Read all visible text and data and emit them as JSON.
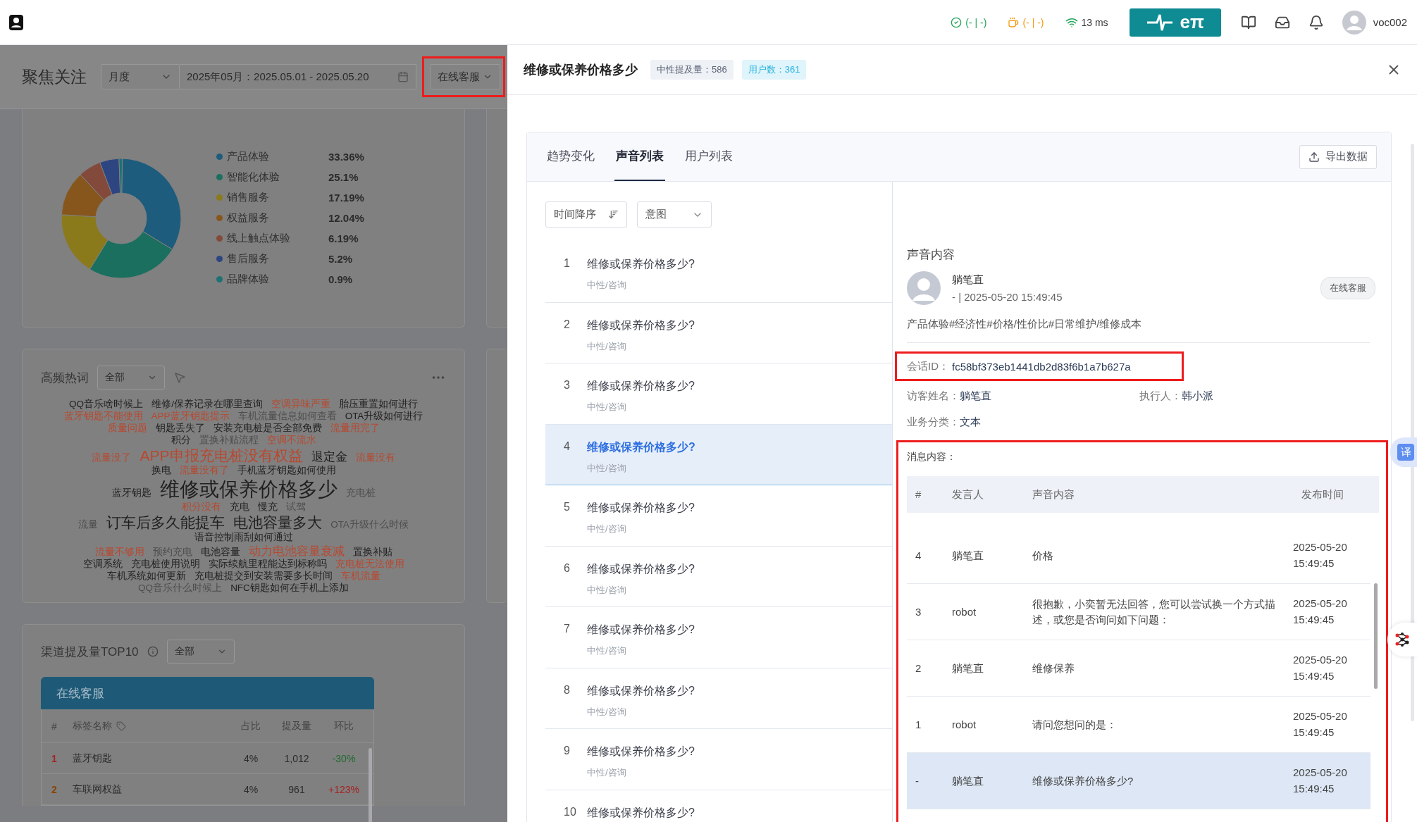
{
  "top_bar": {
    "status": [
      {
        "kind": "check",
        "text": "(- | -)"
      },
      {
        "kind": "cup",
        "text": "(- | -)"
      },
      {
        "kind": "wifi",
        "text": "13 ms"
      }
    ],
    "logo_text": "eπ",
    "username": "voc002"
  },
  "focus": {
    "title": "聚焦关注",
    "period": "月度",
    "date_range": "2025年05月：2025.05.01 - 2025.05.20",
    "channel": {
      "value": "在线客服",
      "highlighted": true
    }
  },
  "distribution": {
    "chart_data": {
      "type": "donut",
      "categories": [
        "产品体验",
        "智能化体验",
        "销售服务",
        "权益服务",
        "线上触点体验",
        "售后服务",
        "品牌体验"
      ],
      "values": [
        33.36,
        25.1,
        17.19,
        12.04,
        6.19,
        5.2,
        0.9
      ]
    },
    "legend": [
      {
        "value": "33.36%",
        "color": "#1d5c7d"
      },
      {
        "value": "25.1%",
        "color": "#1b6f5f"
      },
      {
        "value": "17.19%",
        "color": "#8a7a1c"
      },
      {
        "value": "12.04%",
        "color": "#87561c"
      },
      {
        "value": "6.19%",
        "color": "#834a3c"
      },
      {
        "value": "5.2%",
        "color": "#2d4580"
      },
      {
        "value": "0.9%",
        "color": "#1e7272"
      }
    ]
  },
  "hot_words": {
    "title": "高频热词",
    "filter": "全部",
    "lines": [
      [
        {
          "text": "QQ音乐啥时候上",
          "color": "#1f1f1f",
          "kind": "s"
        },
        {
          "text": "维修/保养记录在哪里查询",
          "color": "#1f1f1f",
          "kind": "s"
        },
        {
          "text": "空调异味严重",
          "color": "#b8482f",
          "kind": "s"
        },
        {
          "text": "胎压重置如何进行",
          "color": "#1f1f1f",
          "kind": "s"
        }
      ],
      [
        {
          "text": "蓝牙钥匙不能使用",
          "color": "#b8482f",
          "kind": "s"
        },
        {
          "text": "APP蓝牙钥匙提示",
          "color": "#b8482f",
          "kind": "s"
        },
        {
          "text": "车机流量信息如何查看",
          "color": "#4d4d4d",
          "kind": "s"
        },
        {
          "text": "OTA升级如何进行",
          "color": "#1f1f1f",
          "kind": "s"
        }
      ],
      [
        {
          "text": "质量问题",
          "color": "#b8482f",
          "kind": "s"
        },
        {
          "text": "钥匙丢失了",
          "color": "#1f1f1f",
          "kind": "s"
        },
        {
          "text": "安装充电桩是否全部免费",
          "color": "#1f1f1f",
          "kind": "s"
        },
        {
          "text": "流量用完了",
          "color": "#b8482f",
          "kind": "s"
        }
      ],
      [
        {
          "text": "积分",
          "color": "#1f1f1f",
          "kind": "s"
        },
        {
          "text": "置换补贴流程",
          "color": "#4d4d4d",
          "kind": "s"
        },
        {
          "text": "空调不流水",
          "color": "#b8482f",
          "kind": "s"
        }
      ],
      [
        {
          "text": "流量没了",
          "color": "#b8482f",
          "kind": "s"
        },
        {
          "text": "APP申报充电桩没有权益",
          "color": "#b8482f",
          "kind": "l"
        },
        {
          "text": "退定金",
          "color": "#1f1f1f",
          "kind": "m"
        },
        {
          "text": "流量没有",
          "color": "#b8482f",
          "kind": "s"
        }
      ],
      [
        {
          "text": "换电",
          "color": "#1f1f1f",
          "kind": "s"
        },
        {
          "text": "流量没有了",
          "color": "#b8482f",
          "kind": "s"
        },
        {
          "text": "手机蓝牙钥匙如何使用",
          "color": "#1f1f1f",
          "kind": "s"
        }
      ],
      [
        {
          "text": "蓝牙钥匙",
          "color": "#1f1f1f",
          "kind": "s"
        },
        {
          "text": "维修或保养价格多少",
          "color": "#1f1f1f",
          "kind": "xl"
        },
        {
          "text": "充电桩",
          "color": "#4d4d4d",
          "kind": "s"
        }
      ],
      [
        {
          "text": "积分没有",
          "color": "#b8482f",
          "kind": "s"
        },
        {
          "text": "充电",
          "color": "#1f1f1f",
          "kind": "s"
        },
        {
          "text": "慢充",
          "color": "#1f1f1f",
          "kind": "s"
        },
        {
          "text": "试驾",
          "color": "#4d4d4d",
          "kind": "s"
        }
      ],
      [
        {
          "text": "流量",
          "color": "#4d4d4d",
          "kind": "s"
        },
        {
          "text": "订车后多久能提车",
          "color": "#1f1f1f",
          "kind": "l"
        },
        {
          "text": "电池容量多大",
          "color": "#1f1f1f",
          "kind": "l"
        },
        {
          "text": "OTA升级什么时候",
          "color": "#4d4d4d",
          "kind": "s"
        }
      ],
      [
        {
          "text": "语音控制雨刮如何通过",
          "color": "#1f1f1f",
          "kind": "s"
        }
      ],
      [
        {
          "text": "流量不够用",
          "color": "#b8482f",
          "kind": "s"
        },
        {
          "text": "预约充电",
          "color": "#4d4d4d",
          "kind": "s"
        },
        {
          "text": "电池容量",
          "color": "#1f1f1f",
          "kind": "s"
        },
        {
          "text": "动力电池容量衰减",
          "color": "#b8482f",
          "kind": "m"
        },
        {
          "text": "置换补贴",
          "color": "#1f1f1f",
          "kind": "s"
        }
      ],
      [
        {
          "text": "空调系统",
          "color": "#1f1f1f",
          "kind": "s"
        },
        {
          "text": "充电桩使用说明",
          "color": "#1f1f1f",
          "kind": "s"
        },
        {
          "text": "实际续航里程能达到标称吗",
          "color": "#1f1f1f",
          "kind": "s"
        },
        {
          "text": "充电桩无法使用",
          "color": "#b8482f",
          "kind": "s"
        }
      ],
      [
        {
          "text": "车机系统如何更新",
          "color": "#1f1f1f",
          "kind": "s"
        },
        {
          "text": "充电桩提交到安装需要多长时间",
          "color": "#1f1f1f",
          "kind": "s"
        },
        {
          "text": "车机流量",
          "color": "#b8482f",
          "kind": "s"
        }
      ],
      [
        {
          "text": "QQ音乐什么时候上",
          "color": "#4d4d4d",
          "kind": "s"
        },
        {
          "text": "NFC钥匙如何在手机上添加",
          "color": "#1f1f1f",
          "kind": "s"
        }
      ]
    ]
  },
  "channel_top": {
    "title": "渠道提及量TOP10",
    "filter": "全部",
    "channel": "在线客服",
    "columns": [
      "#",
      "标签名称",
      "占比",
      "提及量",
      "环比"
    ],
    "rows": [
      {
        "rank": "1",
        "color": "#a32424",
        "name": "蓝牙钥匙",
        "share": "4%",
        "mentions": "1,012",
        "change": "-30%",
        "kind": "down"
      },
      {
        "rank": "2",
        "color": "#8a4206",
        "name": "车联网权益",
        "share": "4%",
        "mentions": "961",
        "change": "+123%",
        "kind": "up"
      }
    ]
  },
  "drawer": {
    "title": "维修或保养价格多少",
    "tags": [
      {
        "text": "中性提及量：586",
        "kind": "neutral"
      },
      {
        "text": "用户数：361",
        "kind": "users"
      }
    ],
    "tabs": [
      {
        "label": "趋势变化",
        "selected": false
      },
      {
        "label": "声音列表",
        "selected": true
      },
      {
        "label": "用户列表",
        "selected": false
      }
    ],
    "export": "导出数据",
    "sort": "时间降序",
    "intent": "意图",
    "voices": [
      {
        "index": "1",
        "text": "维修或保养价格多少?",
        "sub": "中性/咨询",
        "selected": false
      },
      {
        "index": "2",
        "text": "维修或保养价格多少?",
        "sub": "中性/咨询",
        "selected": false
      },
      {
        "index": "3",
        "text": "维修或保养价格多少?",
        "sub": "中性/咨询",
        "selected": false
      },
      {
        "index": "4",
        "text": "维修或保养价格多少?",
        "sub": "中性/咨询",
        "selected": true
      },
      {
        "index": "5",
        "text": "维修或保养价格多少?",
        "sub": "中性/咨询",
        "selected": false
      },
      {
        "index": "6",
        "text": "维修或保养价格多少?",
        "sub": "中性/咨询",
        "selected": false
      },
      {
        "index": "7",
        "text": "维修或保养价格多少?",
        "sub": "中性/咨询",
        "selected": false
      },
      {
        "index": "8",
        "text": "维修或保养价格多少?",
        "sub": "中性/咨询",
        "selected": false
      },
      {
        "index": "9",
        "text": "维修或保养价格多少?",
        "sub": "中性/咨询",
        "selected": false
      },
      {
        "index": "10",
        "text": "维修或保养价格多少?",
        "selected": false
      }
    ],
    "detail": {
      "title": "声音内容",
      "author": "躺笔直",
      "meta": "- | 2025-05-20 15:49:45",
      "channel": "在线客服",
      "tags": "产品体验#经济性#价格/性价比#日常维护/维修成本",
      "session": {
        "label": "会话ID：",
        "value": "fc58bf373eb1441db2d83f6b1a7b627a",
        "highlighted": true
      },
      "fields": [
        {
          "label": "访客姓名：",
          "value": "躺笔直"
        },
        {
          "label": "执行人：",
          "value": "韩小派"
        },
        {
          "label": "业务分类：",
          "value": "文本"
        }
      ],
      "messages": {
        "title": "消息内容：",
        "highlighted": true,
        "columns": [
          "#",
          "发言人",
          "声音内容",
          "发布时间"
        ],
        "rows": [
          {
            "index": "4",
            "speaker": "躺笔直",
            "content": "价格",
            "time": "2025-05-20 15:49:45",
            "selected": false
          },
          {
            "index": "3",
            "speaker": "robot",
            "content": "很抱歉，小奕暂无法回答，您可以尝试换一个方式描述，或您是否询问如下问题：",
            "time": "2025-05-20 15:49:45",
            "selected": false
          },
          {
            "index": "2",
            "speaker": "躺笔直",
            "content": "维修保养",
            "time": "2025-05-20 15:49:45",
            "selected": false
          },
          {
            "index": "1",
            "speaker": "robot",
            "content": "请问您想问的是：",
            "time": "2025-05-20 15:49:45",
            "selected": false
          },
          {
            "index": "-",
            "speaker": "躺笔直",
            "content": "维修或保养价格多少?",
            "time": "2025-05-20 15:49:45",
            "selected": true
          }
        ]
      }
    }
  },
  "side_tools": {
    "translate": "译"
  }
}
